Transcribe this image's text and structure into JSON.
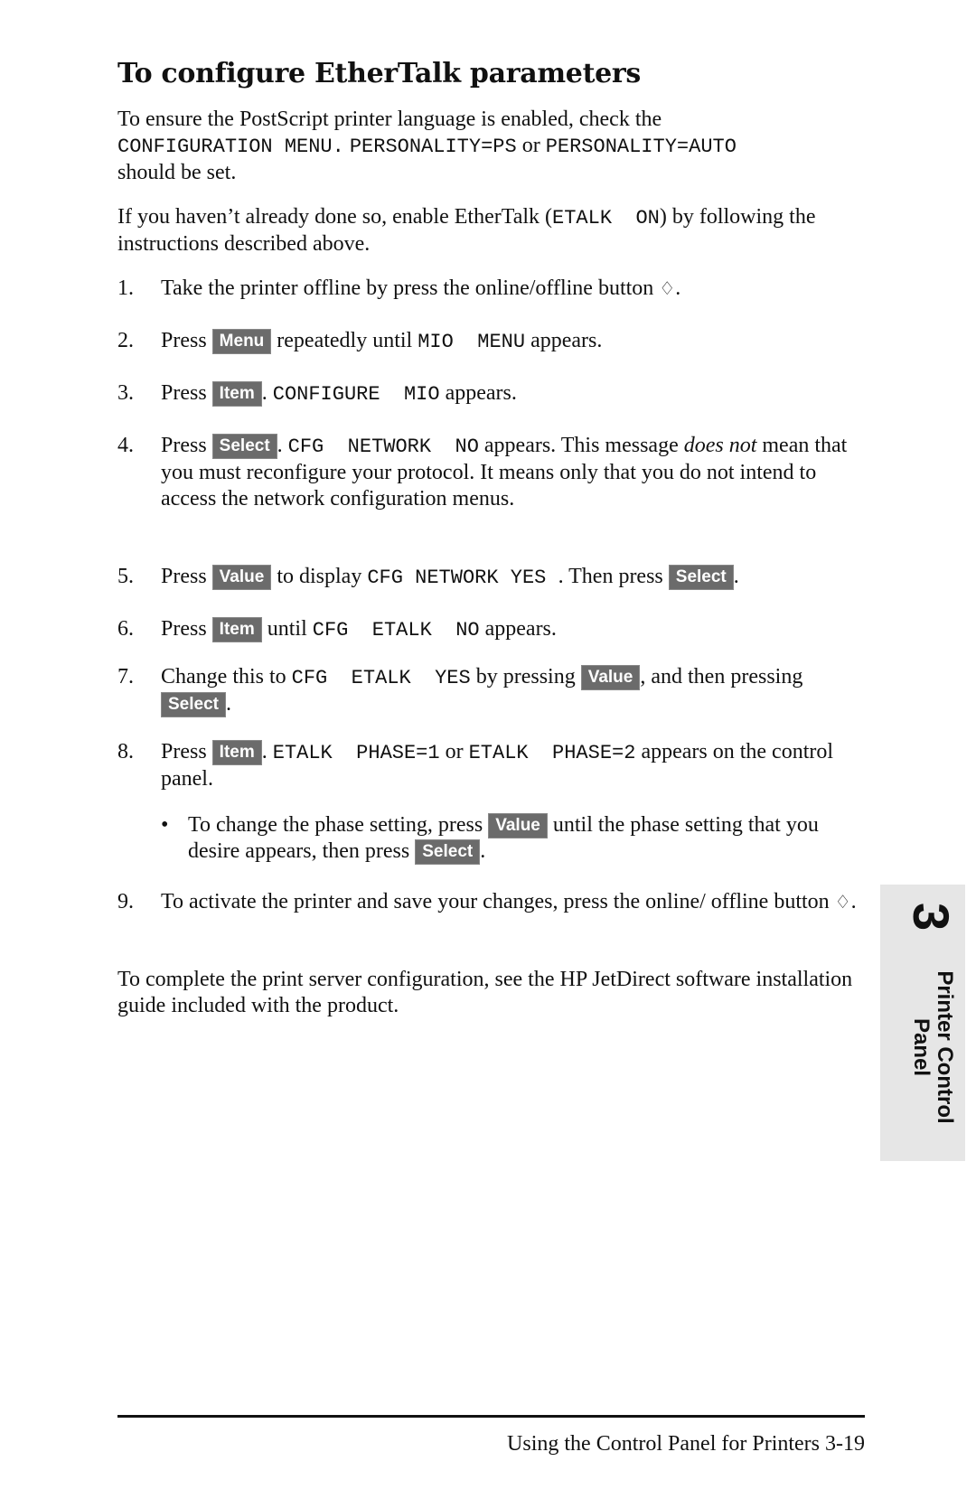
{
  "title": "To configure EtherTalk parameters",
  "intro1": {
    "t1": "To ensure the PostScript printer language is enabled, check the",
    "m1": "CONFIGURATION MENU.",
    "m2": "PERSONALITY=PS",
    "t2": " or ",
    "m3": "PERSONALITY=AUTO",
    "t3": "should be set."
  },
  "intro2": {
    "t1": "If you haven’t already done so, enable EtherTalk (",
    "m1": "ETALK  ON",
    "t2": ") by following the instructions described above."
  },
  "keys": {
    "menu": "Menu",
    "item": "Item",
    "select": "Select",
    "value": "Value"
  },
  "icons": {
    "online_offline": "♢"
  },
  "steps": [
    {
      "num": "1.",
      "t1": "Take the printer offline by press the online/offline button ",
      "t2": "."
    },
    {
      "num": "2.",
      "t1": "Press ",
      "t2": " repeatedly until ",
      "m1": "MIO  MENU",
      "t3": " appears."
    },
    {
      "num": "3.",
      "t1": "Press ",
      "t2": ". ",
      "m1": "CONFIGURE  MIO",
      "t3": " appears."
    },
    {
      "num": "4.",
      "t1": "Press ",
      "t2": ". ",
      "m1": "CFG  NETWORK  NO",
      "t3": " appears. This message ",
      "i1": "does not",
      "t4": " mean that you must reconfigure your protocol. It means only that you do not intend to access the network configuration menus."
    },
    {
      "num": "5.",
      "t1": "Press ",
      "t2": " to display ",
      "m1": "CFG NETWORK YES ",
      "t3": ". Then press ",
      "t4": "."
    },
    {
      "num": "6.",
      "t1": "Press ",
      "t2": " until ",
      "m1": "CFG  ETALK  NO",
      "t3": " appears."
    },
    {
      "num": "7.",
      "t1": "Change this to ",
      "m1": "CFG  ETALK  YES",
      "t2": " by pressing ",
      "t3": ", and then pressing ",
      "t4": "."
    },
    {
      "num": "8.",
      "t1": "Press ",
      "t2": ". ",
      "m1": "ETALK  PHASE=1",
      "t3": " or ",
      "m2": "ETALK  PHASE=2",
      "t4": " appears on the control panel."
    },
    {
      "num": "9.",
      "t1": "To activate the printer and save your changes, press the online/ offline button ",
      "t2": "."
    }
  ],
  "bullet": {
    "dot": "•",
    "t1": "To change the phase setting, press ",
    "t2": " until the phase setting that you desire appears, then press ",
    "t3": "."
  },
  "closing": "To complete the print server configuration, see the HP JetDirect software installation guide included with the product.",
  "side_tab": {
    "number": "3",
    "line1": "Printer Control",
    "line2": "Panel"
  },
  "footer": "Using the Control Panel for Printers 3-19"
}
